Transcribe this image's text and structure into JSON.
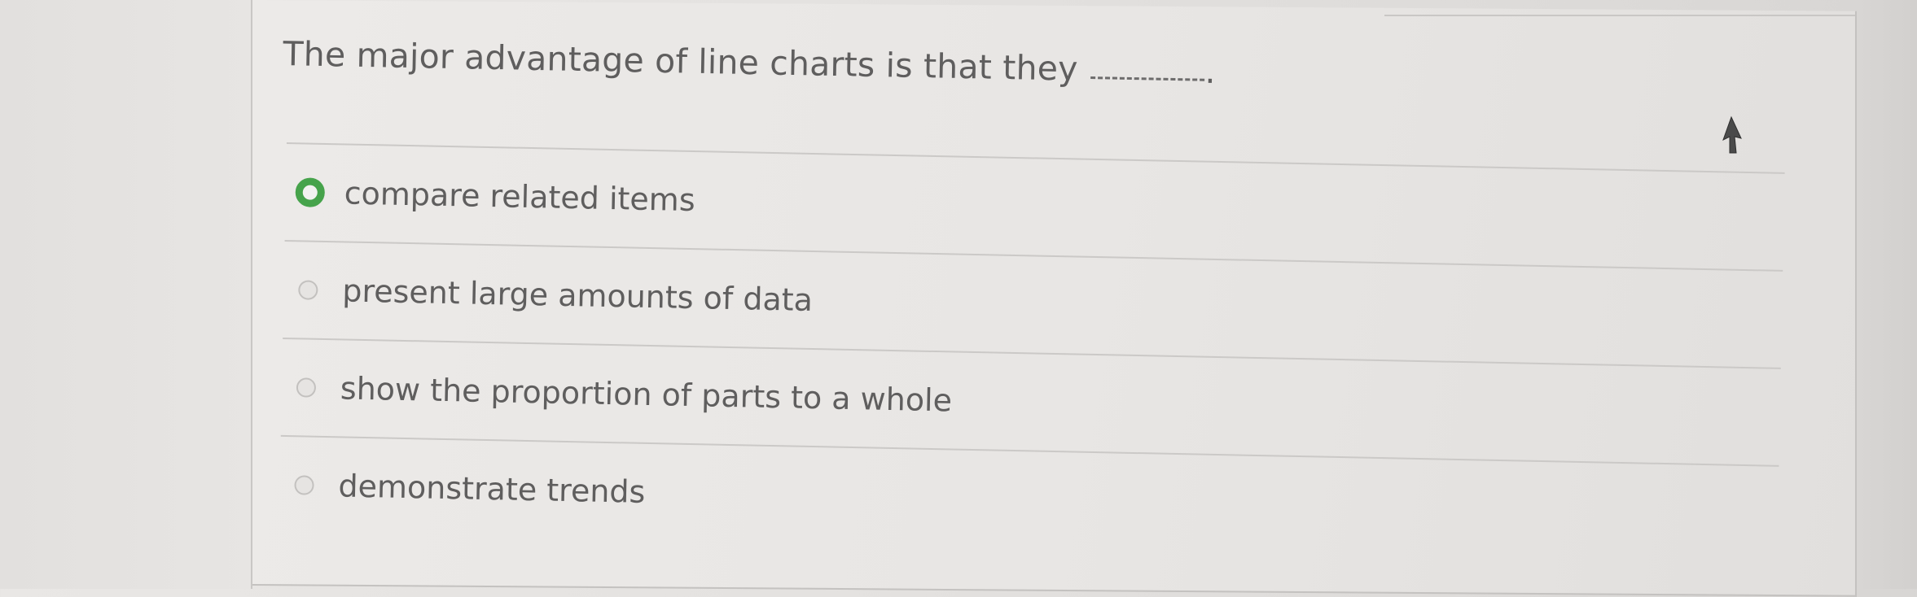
{
  "question": {
    "text": "The major advantage of line charts is that they",
    "trailing": "."
  },
  "options": [
    {
      "label": "compare related items",
      "selected": true
    },
    {
      "label": "present large amounts of data",
      "selected": false
    },
    {
      "label": "show the proportion of parts to a whole",
      "selected": false
    },
    {
      "label": "demonstrate trends",
      "selected": false
    }
  ],
  "colors": {
    "selected_radio": "#46a34b",
    "text": "#5f5e5e",
    "divider": "#cbc9c7"
  },
  "icons": {
    "cursor": "mouse-pointer-icon"
  }
}
